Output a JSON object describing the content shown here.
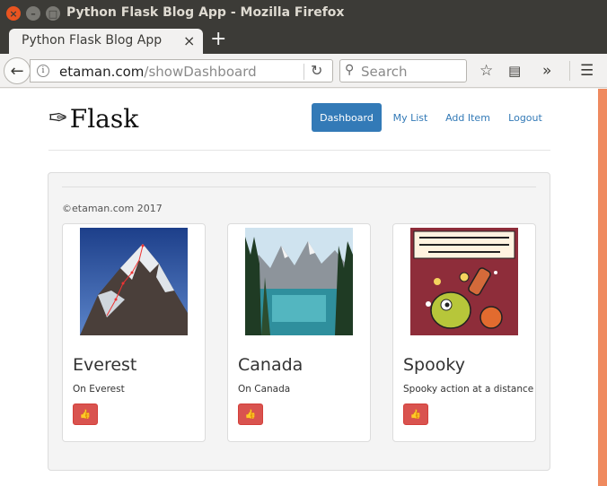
{
  "window": {
    "title": "Python Flask Blog App - Mozilla Firefox"
  },
  "tab": {
    "title": "Python Flask Blog App",
    "close": "×",
    "new_tab": "+"
  },
  "navbar": {
    "url_host": "etaman.com",
    "url_path": "/showDashboard",
    "search_placeholder": "Search"
  },
  "site": {
    "logo_text": "Flask",
    "nav": [
      {
        "label": "Dashboard",
        "active": true
      },
      {
        "label": "My List",
        "active": false
      },
      {
        "label": "Add Item",
        "active": false
      },
      {
        "label": "Logout",
        "active": false
      }
    ],
    "copyright": "©etaman.com 2017"
  },
  "cards": [
    {
      "title": "Everest",
      "description": "On Everest",
      "image": "mountain-everest-photo"
    },
    {
      "title": "Canada",
      "description": "On Canada",
      "image": "canada-lake-photo"
    },
    {
      "title": "Spooky",
      "description": "Spooky action at a distance",
      "image": "spooky-comic-illustration"
    }
  ],
  "colors": {
    "primary": "#337ab7",
    "danger": "#d9534f",
    "titlebar": "#3c3b37",
    "accent_scroll": "#ef8a5f"
  }
}
